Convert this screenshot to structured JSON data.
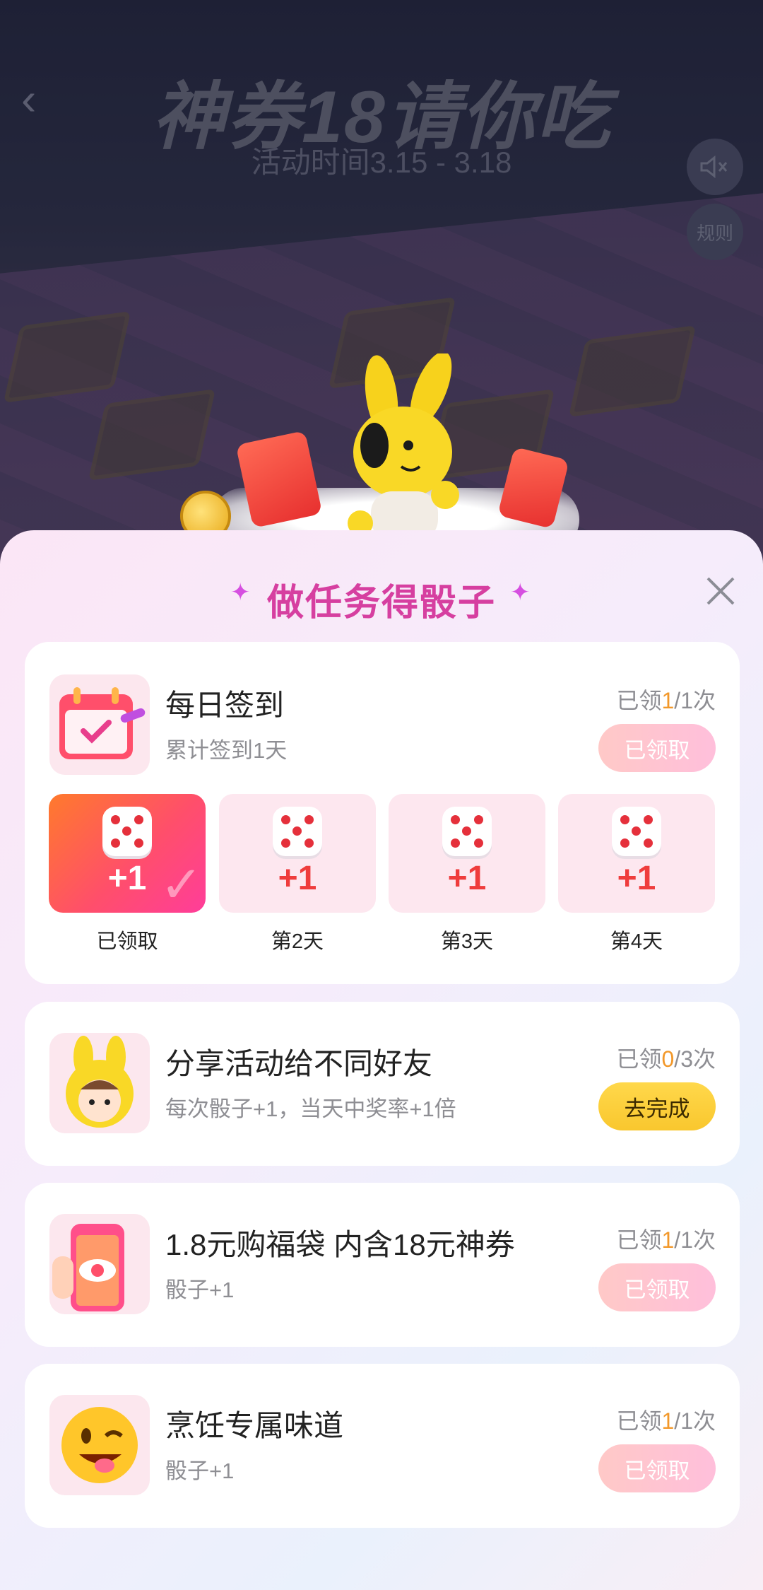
{
  "header": {
    "back_icon": "chevron-left-icon",
    "title": "神券18请你吃",
    "subtitle": "活动时间3.15 - 3.18",
    "sound_icon": "mute-speaker-icon",
    "rules_label": "规则"
  },
  "sheet": {
    "title": "做任务得骰子",
    "close_icon": "close-icon",
    "accent_color": "#d63fa0"
  },
  "tasks": [
    {
      "title": "每日签到",
      "desc": "累计签到1天",
      "count_prefix": "已领",
      "count_done": "1",
      "count_total": "/1次",
      "button": "已领取",
      "icon": "calendar-check-icon",
      "days": [
        {
          "reward": "+1",
          "label": "已领取",
          "claimed": true
        },
        {
          "reward": "+1",
          "label": "第2天",
          "claimed": false
        },
        {
          "reward": "+1",
          "label": "第3天",
          "claimed": false
        },
        {
          "reward": "+1",
          "label": "第4天",
          "claimed": false
        }
      ]
    },
    {
      "title": "分享活动给不同好友",
      "desc": "每次骰子+1，当天中奖率+1倍",
      "count_prefix": "已领",
      "count_done": "0",
      "count_total": "/3次",
      "button": "去完成",
      "icon": "yellow-bunny-mascot-icon"
    },
    {
      "title": "1.8元购福袋 内含18元神券",
      "desc": "骰子+1",
      "count_prefix": "已领",
      "count_done": "1",
      "count_total": "/1次",
      "button": "已领取",
      "icon": "phone-eye-icon"
    },
    {
      "title": "烹饪专属味道",
      "desc": "骰子+1",
      "count_prefix": "已领",
      "count_done": "1",
      "count_total": "/1次",
      "button": "已领取",
      "icon": "winking-emoji-icon"
    }
  ]
}
